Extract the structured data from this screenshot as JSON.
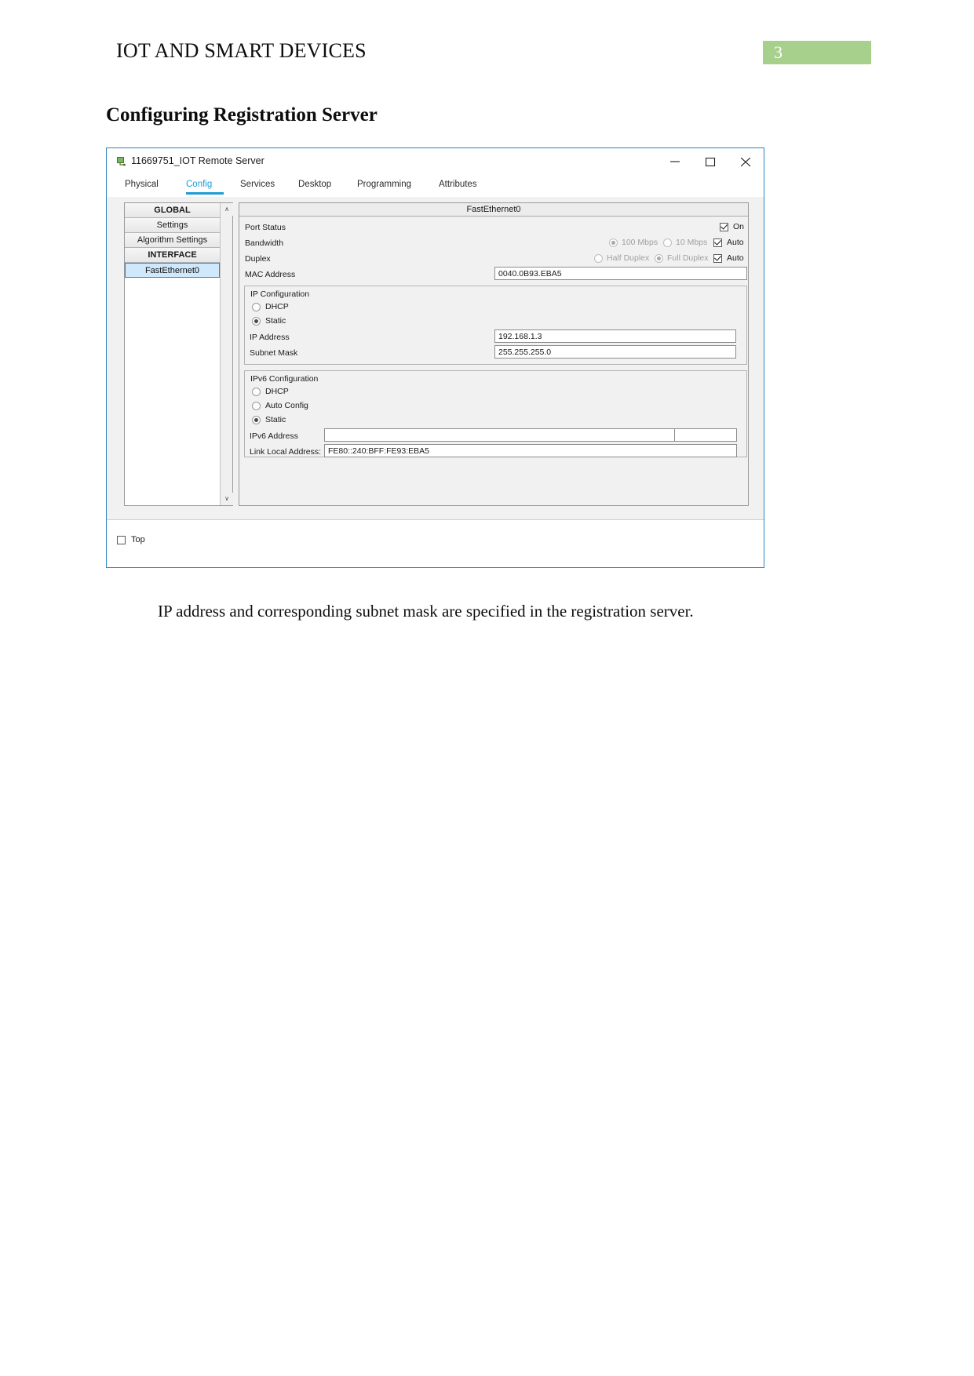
{
  "document": {
    "header_title": "IOT AND SMART DEVICES",
    "page_number": "3",
    "page_badge_color": "#a8d08d",
    "section_heading": "Configuring Registration Server",
    "caption": "IP address and corresponding subnet mask are specified in the registration server."
  },
  "window": {
    "title": "11669751_IOT Remote Server",
    "icon": "packet-tracer-device-icon",
    "minimize_glyph": "─",
    "maximize_glyph": "□",
    "close_glyph": "✕",
    "accent_color": "#1e9bd7"
  },
  "tabs": [
    {
      "label": "Physical",
      "active": false
    },
    {
      "label": "Config",
      "active": true
    },
    {
      "label": "Services",
      "active": false
    },
    {
      "label": "Desktop",
      "active": false
    },
    {
      "label": "Programming",
      "active": false
    },
    {
      "label": "Attributes",
      "active": false
    }
  ],
  "sidebar": {
    "items": [
      {
        "label": "GLOBAL",
        "type": "header",
        "selected": false
      },
      {
        "label": "Settings",
        "type": "item",
        "selected": false
      },
      {
        "label": "Algorithm Settings",
        "type": "item",
        "selected": false
      },
      {
        "label": "INTERFACE",
        "type": "header",
        "selected": false
      },
      {
        "label": "FastEthernet0",
        "type": "item",
        "selected": true
      }
    ],
    "scroll_up_glyph": "∧",
    "scroll_down_glyph": "∨"
  },
  "config": {
    "panel_title": "FastEthernet0",
    "port_status": {
      "label": "Port Status",
      "on_label": "On",
      "on_checked": true
    },
    "bandwidth": {
      "label": "Bandwidth",
      "option_100_label": "100 Mbps",
      "option_100_selected": true,
      "option_10_label": "10 Mbps",
      "option_10_selected": false,
      "auto_label": "Auto",
      "auto_checked": true
    },
    "duplex": {
      "label": "Duplex",
      "half_label": "Half Duplex",
      "half_selected": false,
      "full_label": "Full Duplex",
      "full_selected": true,
      "auto_label": "Auto",
      "auto_checked": true
    },
    "mac_address": {
      "label": "MAC Address",
      "value": "0040.0B93.EBA5"
    },
    "ip_configuration": {
      "group_title": "IP Configuration",
      "dhcp_label": "DHCP",
      "dhcp_selected": false,
      "static_label": "Static",
      "static_selected": true,
      "ip_address_label": "IP Address",
      "ip_address_value": "192.168.1.3",
      "subnet_mask_label": "Subnet Mask",
      "subnet_mask_value": "255.255.255.0"
    },
    "ipv6_configuration": {
      "group_title": "IPv6 Configuration",
      "dhcp_label": "DHCP",
      "dhcp_selected": false,
      "auto_config_label": "Auto Config",
      "auto_config_selected": false,
      "static_label": "Static",
      "static_selected": true,
      "ipv6_address_label": "IPv6 Address",
      "ipv6_address_value": "",
      "ipv6_prefix_value": "",
      "link_local_label": "Link Local Address:",
      "link_local_value": "FE80::240:BFF:FE93:EBA5"
    }
  },
  "bottom": {
    "top_label": "Top",
    "top_checked": false
  }
}
